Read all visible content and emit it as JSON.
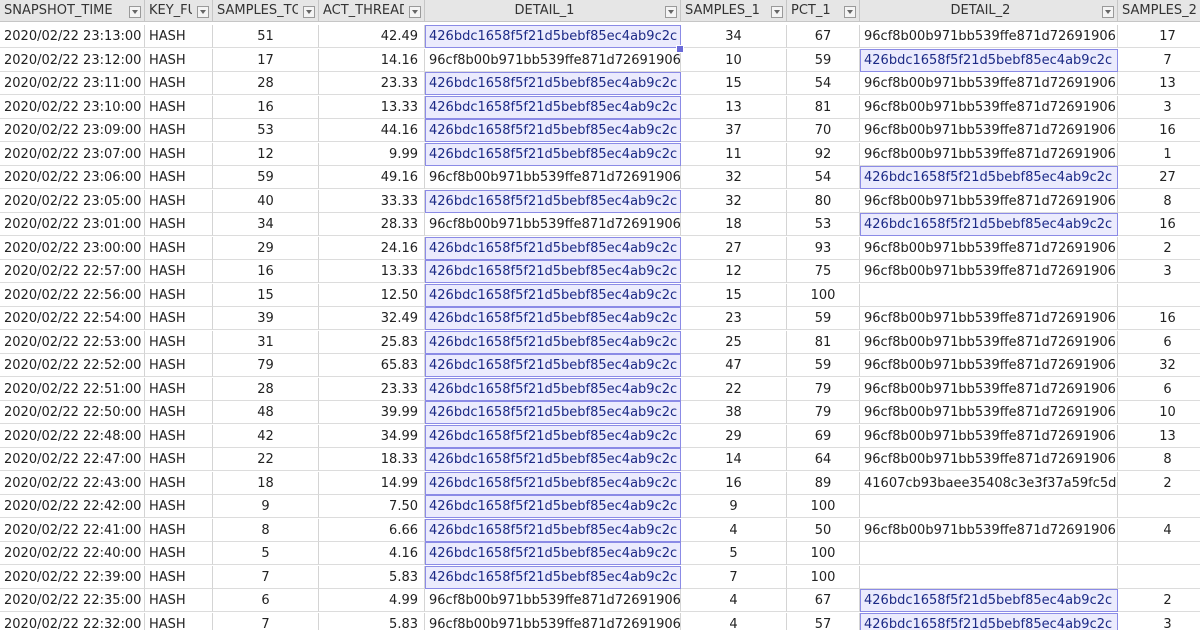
{
  "columns": [
    {
      "key": "snapshot_time",
      "label": "SNAPSHOT_TIME",
      "filter": true
    },
    {
      "key": "key_f",
      "label": "KEY_FU",
      "filter": true
    },
    {
      "key": "samples_t",
      "label": "SAMPLES_TO",
      "filter": true
    },
    {
      "key": "act_thread",
      "label": "ACT_THREAD",
      "filter": true
    },
    {
      "key": "detail_1",
      "label": "DETAIL_1",
      "filter": true
    },
    {
      "key": "samples_1",
      "label": "SAMPLES_1",
      "filter": true
    },
    {
      "key": "pct_1",
      "label": "PCT_1",
      "filter": true
    },
    {
      "key": "detail_2",
      "label": "DETAIL_2",
      "filter": true
    },
    {
      "key": "samples_2",
      "label": "SAMPLES_2",
      "filter": false
    }
  ],
  "rows": [
    [
      "2020/02/22 23:13:00",
      "HASH",
      "51",
      "42.49",
      "426bdc1658f5f21d5bebf85ec4ab9c2c",
      "34",
      "67",
      "96cf8b00b971bb539ffe871d72691906",
      "17"
    ],
    [
      "2020/02/22 23:12:00",
      "HASH",
      "17",
      "14.16",
      "96cf8b00b971bb539ffe871d72691906",
      "10",
      "59",
      "426bdc1658f5f21d5bebf85ec4ab9c2c",
      "7"
    ],
    [
      "2020/02/22 23:11:00",
      "HASH",
      "28",
      "23.33",
      "426bdc1658f5f21d5bebf85ec4ab9c2c",
      "15",
      "54",
      "96cf8b00b971bb539ffe871d72691906",
      "13"
    ],
    [
      "2020/02/22 23:10:00",
      "HASH",
      "16",
      "13.33",
      "426bdc1658f5f21d5bebf85ec4ab9c2c",
      "13",
      "81",
      "96cf8b00b971bb539ffe871d72691906",
      "3"
    ],
    [
      "2020/02/22 23:09:00",
      "HASH",
      "53",
      "44.16",
      "426bdc1658f5f21d5bebf85ec4ab9c2c",
      "37",
      "70",
      "96cf8b00b971bb539ffe871d72691906",
      "16"
    ],
    [
      "2020/02/22 23:07:00",
      "HASH",
      "12",
      "9.99",
      "426bdc1658f5f21d5bebf85ec4ab9c2c",
      "11",
      "92",
      "96cf8b00b971bb539ffe871d72691906",
      "1"
    ],
    [
      "2020/02/22 23:06:00",
      "HASH",
      "59",
      "49.16",
      "96cf8b00b971bb539ffe871d72691906",
      "32",
      "54",
      "426bdc1658f5f21d5bebf85ec4ab9c2c",
      "27"
    ],
    [
      "2020/02/22 23:05:00",
      "HASH",
      "40",
      "33.33",
      "426bdc1658f5f21d5bebf85ec4ab9c2c",
      "32",
      "80",
      "96cf8b00b971bb539ffe871d72691906",
      "8"
    ],
    [
      "2020/02/22 23:01:00",
      "HASH",
      "34",
      "28.33",
      "96cf8b00b971bb539ffe871d72691906",
      "18",
      "53",
      "426bdc1658f5f21d5bebf85ec4ab9c2c",
      "16"
    ],
    [
      "2020/02/22 23:00:00",
      "HASH",
      "29",
      "24.16",
      "426bdc1658f5f21d5bebf85ec4ab9c2c",
      "27",
      "93",
      "96cf8b00b971bb539ffe871d72691906",
      "2"
    ],
    [
      "2020/02/22 22:57:00",
      "HASH",
      "16",
      "13.33",
      "426bdc1658f5f21d5bebf85ec4ab9c2c",
      "12",
      "75",
      "96cf8b00b971bb539ffe871d72691906",
      "3"
    ],
    [
      "2020/02/22 22:56:00",
      "HASH",
      "15",
      "12.50",
      "426bdc1658f5f21d5bebf85ec4ab9c2c",
      "15",
      "100",
      "",
      ""
    ],
    [
      "2020/02/22 22:54:00",
      "HASH",
      "39",
      "32.49",
      "426bdc1658f5f21d5bebf85ec4ab9c2c",
      "23",
      "59",
      "96cf8b00b971bb539ffe871d72691906",
      "16"
    ],
    [
      "2020/02/22 22:53:00",
      "HASH",
      "31",
      "25.83",
      "426bdc1658f5f21d5bebf85ec4ab9c2c",
      "25",
      "81",
      "96cf8b00b971bb539ffe871d72691906",
      "6"
    ],
    [
      "2020/02/22 22:52:00",
      "HASH",
      "79",
      "65.83",
      "426bdc1658f5f21d5bebf85ec4ab9c2c",
      "47",
      "59",
      "96cf8b00b971bb539ffe871d72691906",
      "32"
    ],
    [
      "2020/02/22 22:51:00",
      "HASH",
      "28",
      "23.33",
      "426bdc1658f5f21d5bebf85ec4ab9c2c",
      "22",
      "79",
      "96cf8b00b971bb539ffe871d72691906",
      "6"
    ],
    [
      "2020/02/22 22:50:00",
      "HASH",
      "48",
      "39.99",
      "426bdc1658f5f21d5bebf85ec4ab9c2c",
      "38",
      "79",
      "96cf8b00b971bb539ffe871d72691906",
      "10"
    ],
    [
      "2020/02/22 22:48:00",
      "HASH",
      "42",
      "34.99",
      "426bdc1658f5f21d5bebf85ec4ab9c2c",
      "29",
      "69",
      "96cf8b00b971bb539ffe871d72691906",
      "13"
    ],
    [
      "2020/02/22 22:47:00",
      "HASH",
      "22",
      "18.33",
      "426bdc1658f5f21d5bebf85ec4ab9c2c",
      "14",
      "64",
      "96cf8b00b971bb539ffe871d72691906",
      "8"
    ],
    [
      "2020/02/22 22:43:00",
      "HASH",
      "18",
      "14.99",
      "426bdc1658f5f21d5bebf85ec4ab9c2c",
      "16",
      "89",
      "41607cb93baee35408c3e3f37a59fc5d",
      "2"
    ],
    [
      "2020/02/22 22:42:00",
      "HASH",
      "9",
      "7.50",
      "426bdc1658f5f21d5bebf85ec4ab9c2c",
      "9",
      "100",
      "",
      ""
    ],
    [
      "2020/02/22 22:41:00",
      "HASH",
      "8",
      "6.66",
      "426bdc1658f5f21d5bebf85ec4ab9c2c",
      "4",
      "50",
      "96cf8b00b971bb539ffe871d72691906",
      "4"
    ],
    [
      "2020/02/22 22:40:00",
      "HASH",
      "5",
      "4.16",
      "426bdc1658f5f21d5bebf85ec4ab9c2c",
      "5",
      "100",
      "",
      ""
    ],
    [
      "2020/02/22 22:39:00",
      "HASH",
      "7",
      "5.83",
      "426bdc1658f5f21d5bebf85ec4ab9c2c",
      "7",
      "100",
      "",
      ""
    ],
    [
      "2020/02/22 22:35:00",
      "HASH",
      "6",
      "4.99",
      "96cf8b00b971bb539ffe871d72691906",
      "4",
      "67",
      "426bdc1658f5f21d5bebf85ec4ab9c2c",
      "2"
    ],
    [
      "2020/02/22 22:32:00",
      "HASH",
      "7",
      "5.83",
      "96cf8b00b971bb539ffe871d72691906",
      "4",
      "57",
      "426bdc1658f5f21d5bebf85ec4ab9c2c",
      "3"
    ]
  ],
  "highlight_value": "426bdc1658f5f21d5bebf85ec4ab9c2c",
  "colors": {
    "selection_fill": "#ebebfd",
    "selection_border": "#8b8be6",
    "selection_text": "#1c2a86",
    "header_bg": "#e6e6e6",
    "grid_line": "#d4d4d4"
  }
}
